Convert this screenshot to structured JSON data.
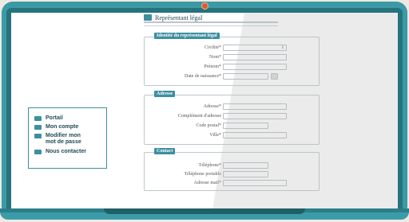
{
  "page": {
    "section_title": "Représentant légal"
  },
  "sections": {
    "identity": {
      "legend": "Identité du représentant légal",
      "civilite_label": "Civilité",
      "nom_label": "Nom",
      "prenom_label": "Prénom",
      "naissance_label": "Date de naissance"
    },
    "address": {
      "legend": "Adresse",
      "adresse_label": "Adresse",
      "complement_label": "Complément d'adresse",
      "codepostal_label": "Code postal",
      "ville_label": "Ville"
    },
    "contact": {
      "legend": "Contact",
      "telephone_label": "Téléphone",
      "portable_label": "Téléphone portable",
      "mail_label": "Adresse mail"
    }
  },
  "required_marker": "*",
  "menu": {
    "items": [
      {
        "label": "Portail",
        "icon": "list-icon"
      },
      {
        "label": "Mon compte",
        "icon": "list-icon"
      },
      {
        "label": "Modifier mon mot de passe",
        "icon": "list-icon"
      },
      {
        "label": "Nous contacter",
        "icon": "list-icon"
      }
    ]
  },
  "colors": {
    "laptop_frame": "#3b9aa6",
    "accent": "#3c8fa0",
    "camera": "#e05a2b"
  }
}
